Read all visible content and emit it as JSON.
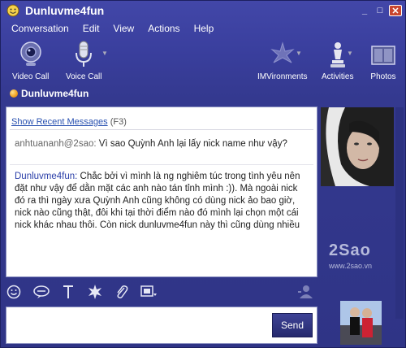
{
  "window": {
    "title": "Dunluvme4fun",
    "controls": [
      "_",
      "□",
      "✕"
    ]
  },
  "menu": [
    "Conversation",
    "Edit",
    "View",
    "Actions",
    "Help"
  ],
  "toolbar": {
    "video_call": "Video Call",
    "voice_call": "Voice Call",
    "imvironments": "IMVironments",
    "activities": "Activities",
    "photos": "Photos"
  },
  "contact": {
    "name": "Dunluvme4fun",
    "status_color": "#f0a020"
  },
  "chat": {
    "recent_link": "Show Recent Messages",
    "recent_key": "(F3)",
    "messages": [
      {
        "sender": "anhtuananh@2sao:",
        "text": " Vì sao Quỳnh Anh lại lấy nick name như vậy?"
      },
      {
        "sender": "Dunluvme4fun:",
        "text": " Chắc bởi vì mình là ng nghiêm túc trong tình yêu nên đặt như vậy để dằn mặt các anh nào tán tỉnh mình :)). Mà ngoài nick đó ra thì ngày xưa Quỳnh Anh cũng không có dùng nick ảo bao giờ, nick nào cũng thật, đôi khi tại thời điểm nào đó mình lại chọn một cái nick khác nhau thôi. Còn nick dunluvme4fun này thì cũng dùng nhiều"
      }
    ]
  },
  "watermark": {
    "logo": "2Sao",
    "url": "www.2sao.vn"
  },
  "input": {
    "value": "",
    "send_label": "Send"
  },
  "colors": {
    "window_bg": "#3a3f9e",
    "link": "#2850b0",
    "my_name": "#2a3ea8"
  }
}
